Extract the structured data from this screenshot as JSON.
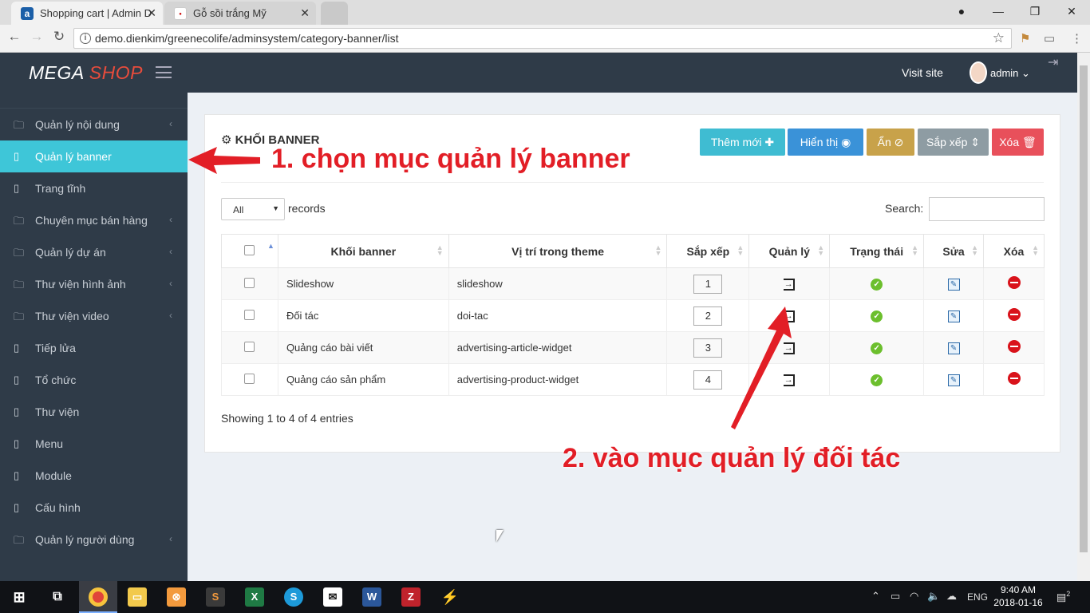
{
  "browser": {
    "tabs": [
      {
        "title": "Shopping cart | Admin D",
        "active": true
      },
      {
        "title": "Gỗ sồi trắng Mỹ",
        "active": false
      }
    ],
    "url": "demo.dienkim/greenecolife/adminsystem/category-banner/list"
  },
  "header": {
    "logo_mega": "MEGA",
    "logo_shop": "SHOP",
    "visit_site": "Visit site",
    "user": "admin"
  },
  "sidebar": {
    "items": [
      {
        "label": "Quản lý nội dung",
        "has_children": true
      },
      {
        "label": "Quản lý banner",
        "active": true
      },
      {
        "label": "Trang tĩnh"
      },
      {
        "label": "Chuyên mục bán hàng",
        "has_children": true
      },
      {
        "label": "Quản lý dự án",
        "has_children": true
      },
      {
        "label": "Thư viện hình ảnh",
        "has_children": true
      },
      {
        "label": "Thư viện video",
        "has_children": true
      },
      {
        "label": "Tiếp lửa"
      },
      {
        "label": "Tổ chức"
      },
      {
        "label": "Thư viện"
      },
      {
        "label": "Menu"
      },
      {
        "label": "Module"
      },
      {
        "label": "Cấu hình"
      },
      {
        "label": "Quản lý người dùng",
        "has_children": true
      }
    ]
  },
  "panel": {
    "title": "KHỐI BANNER",
    "actions": [
      {
        "label": "Thêm mới",
        "icon": "plus-icon",
        "color": "#3fbcd2"
      },
      {
        "label": "Hiển thị",
        "icon": "eye-icon",
        "color": "#3a92d8"
      },
      {
        "label": "Ẩn",
        "icon": "eye-slash-icon",
        "color": "#c8a24a"
      },
      {
        "label": "Sắp xếp",
        "icon": "sort-icon",
        "color": "#8e9ca3"
      },
      {
        "label": "Xóa",
        "icon": "trash-icon",
        "color": "#e8505b"
      }
    ],
    "length_value": "All",
    "records_label": "records",
    "search_label": "Search:",
    "columns": [
      "Khối banner",
      "Vị trí trong theme",
      "Sắp xếp",
      "Quản lý",
      "Trạng thái",
      "Sửa",
      "Xóa"
    ],
    "rows": [
      {
        "name": "Slideshow",
        "position": "slideshow",
        "order": "1"
      },
      {
        "name": "Đối tác",
        "position": "doi-tac",
        "order": "2"
      },
      {
        "name": "Quảng cáo bài viết",
        "position": "advertising-article-widget",
        "order": "3"
      },
      {
        "name": "Quảng cáo sản phẩm",
        "position": "advertising-product-widget",
        "order": "4"
      }
    ],
    "info": "Showing 1 to 4 of 4 entries"
  },
  "annotations": {
    "step1": "1. chọn mục quản lý banner",
    "step2": "2. vào mục quản lý đối tác"
  },
  "taskbar": {
    "lang": "ENG",
    "time": "9:40 AM",
    "date": "2018-01-16",
    "notifications": "2"
  }
}
